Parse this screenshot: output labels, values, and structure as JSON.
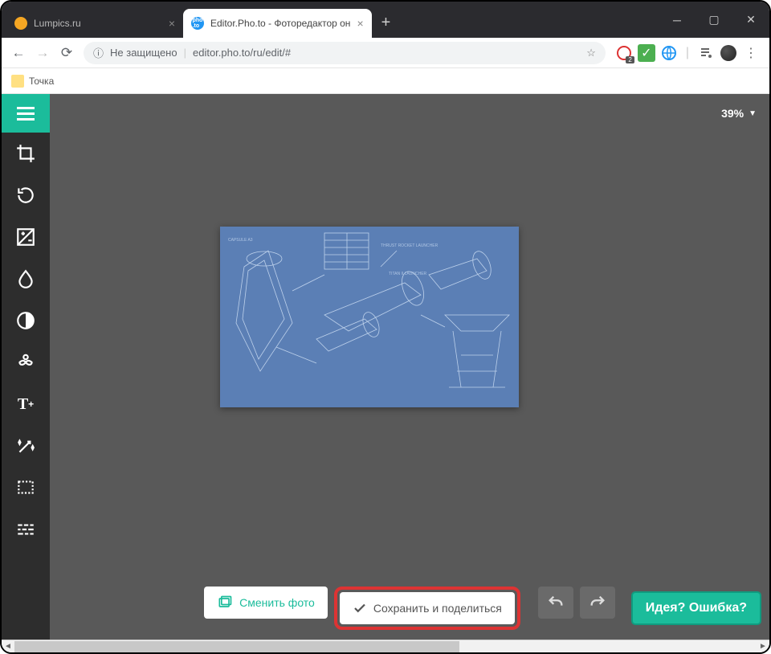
{
  "tabs": [
    {
      "label": "Lumpics.ru"
    },
    {
      "label": "Editor.Pho.to - Фоторедактор он"
    }
  ],
  "url": {
    "insecure": "Не защищено",
    "value": "editor.pho.to/ru/edit/#"
  },
  "bookmark": "Точка",
  "ext_badge": "2",
  "zoom": {
    "value": "39%"
  },
  "tools": [
    "crop",
    "rotate",
    "exposure",
    "blur",
    "contrast",
    "mustache",
    "text",
    "wand",
    "frame",
    "brick"
  ],
  "buttons": {
    "change": "Сменить фото",
    "save": "Сохранить и поделиться"
  },
  "feedback": "Идея? Ошибка?"
}
